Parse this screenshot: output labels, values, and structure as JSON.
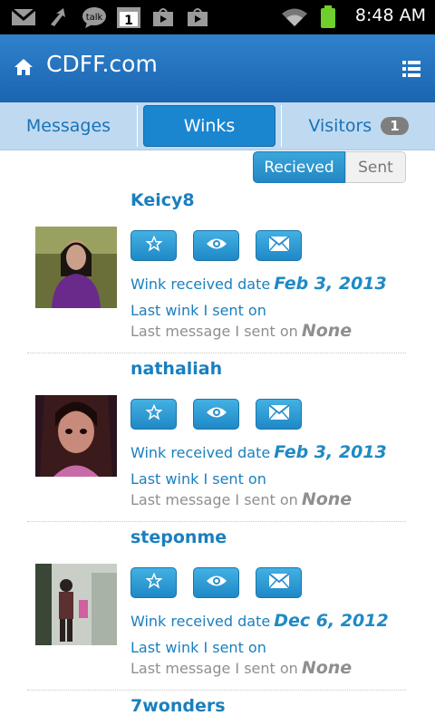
{
  "status_bar": {
    "time": "8:48 AM",
    "icons": [
      "gmail-icon",
      "sync-icon",
      "talk-icon",
      "calendar-icon",
      "play-store-icon",
      "play-store-icon",
      "wifi-icon",
      "battery-icon"
    ],
    "talk_label": "talk",
    "calendar_day": "1"
  },
  "header": {
    "title": "CDFF.com",
    "icons": [
      "home-icon",
      "list-menu-icon"
    ]
  },
  "tabs": [
    {
      "label": "Messages",
      "active": false
    },
    {
      "label": "Winks",
      "active": true
    },
    {
      "label": "Visitors",
      "active": false,
      "badge": "1"
    }
  ],
  "toggle": {
    "received_label": "Recieved",
    "sent_label": "Sent",
    "selected": "received"
  },
  "labels": {
    "wink_received": "Wink received date",
    "last_wink": "Last wink I sent on",
    "last_message": "Last message I sent on"
  },
  "actions": [
    "favorite-star-icon",
    "view-eye-icon",
    "message-envelope-icon"
  ],
  "list": [
    {
      "name": "Keicy8",
      "wink_received_date": "Feb 3, 2013",
      "last_wink_sent": "",
      "last_message_sent": "None"
    },
    {
      "name": "nathaliah",
      "wink_received_date": "Feb 3, 2013",
      "last_wink_sent": "",
      "last_message_sent": "None"
    },
    {
      "name": "steponme",
      "wink_received_date": "Dec 6, 2012",
      "last_wink_sent": "",
      "last_message_sent": "None"
    },
    {
      "name": "7wonders"
    }
  ],
  "colors": {
    "brand_blue": "#1a64b0",
    "link_blue": "#1a7fbe",
    "tab_bar": "#bfdaf0",
    "active_tab": "#1a86d0",
    "muted": "#8f8f8f"
  }
}
